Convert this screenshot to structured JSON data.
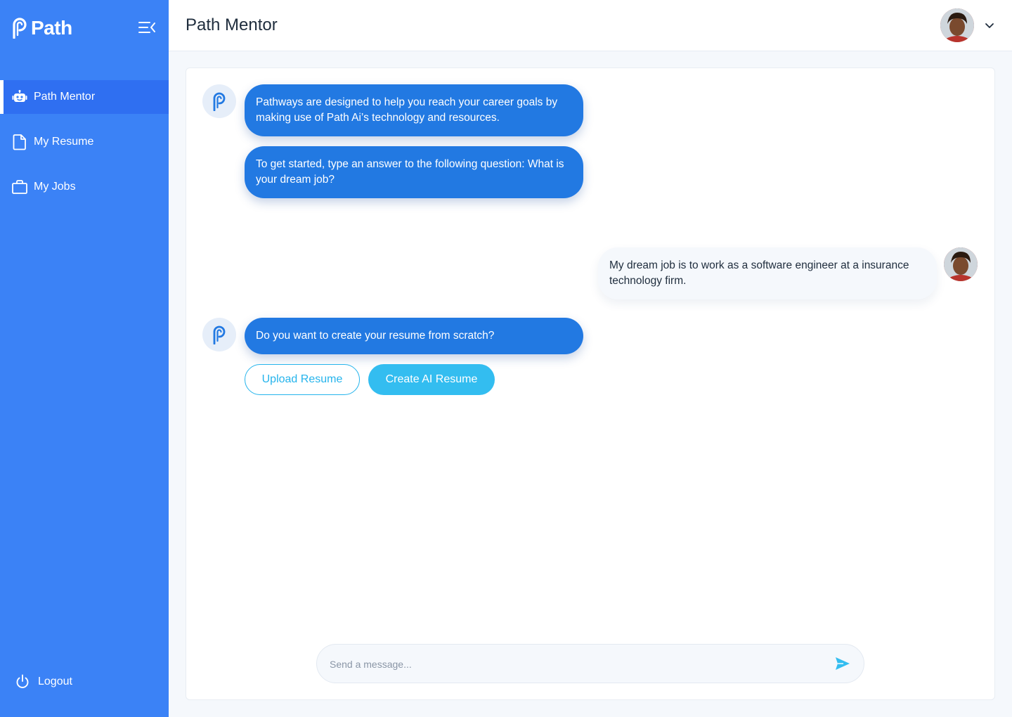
{
  "brand": {
    "name": "Path"
  },
  "sidebar": {
    "items": [
      {
        "label": "Path Mentor",
        "icon": "robot-icon",
        "active": true
      },
      {
        "label": "My Resume",
        "icon": "document-icon",
        "active": false
      },
      {
        "label": "My Jobs",
        "icon": "briefcase-icon",
        "active": false
      }
    ],
    "logout_label": "Logout"
  },
  "header": {
    "title": "Path Mentor"
  },
  "chat": {
    "messages": [
      {
        "from": "bot",
        "text": "Pathways are designed to help you reach your career goals by making use of Path Ai’s technology and resources."
      },
      {
        "from": "bot",
        "text": "To get started, type an answer to the following question: What is your dream job?"
      },
      {
        "from": "user",
        "text": "My dream job is to work as a software engineer at a insurance technology firm."
      },
      {
        "from": "bot",
        "text": "Do you want to create your resume from scratch?"
      }
    ],
    "actions": {
      "upload_label": "Upload Resume",
      "create_label": "Create AI Resume"
    }
  },
  "composer": {
    "placeholder": "Send a message...",
    "value": ""
  },
  "colors": {
    "sidebar": "#3b82f6",
    "sidebar_active": "#2f6ff1",
    "bot_bubble": "#2279e2",
    "accent": "#33bdf0"
  }
}
